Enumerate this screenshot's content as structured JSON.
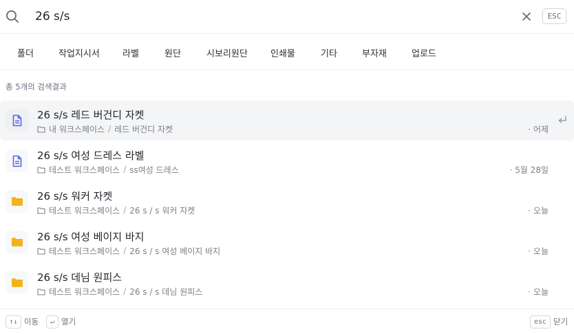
{
  "search": {
    "value": "26 s/s",
    "esc_label": "ESC"
  },
  "tabs": [
    {
      "label": "폴더"
    },
    {
      "label": "작업지시서"
    },
    {
      "label": "라벨"
    },
    {
      "label": "원단"
    },
    {
      "label": "시보리원단"
    },
    {
      "label": "인쇄물"
    },
    {
      "label": "기타"
    },
    {
      "label": "부자재"
    },
    {
      "label": "업로드"
    }
  ],
  "result_count": "총 5개의 검색결과",
  "results": [
    {
      "icon": "document-icon",
      "title": "26 s/s 레드 버건디 자켓",
      "workspace": "내 워크스페이스",
      "path": "레드 버건디 자켓",
      "date": "· 어제"
    },
    {
      "icon": "document-icon",
      "title": "26 s/s 여성 드레스 라벨",
      "workspace": "테스트 워크스페이스",
      "path": "ss여성 드레스",
      "date": "· 5월 28일"
    },
    {
      "icon": "folder-icon",
      "title": "26 s/s 워커 자켓",
      "workspace": "테스트 워크스페이스",
      "path": "26 s / s 워커 자켓",
      "date": "· 오늘"
    },
    {
      "icon": "folder-icon",
      "title": "26 s/s 여성 베이지 바지",
      "workspace": "테스트 워크스페이스",
      "path": "26 s / s 여성 베이지 바지",
      "date": "· 오늘"
    },
    {
      "icon": "folder-icon",
      "title": "26 s/s 데님 원피스",
      "workspace": "테스트 워크스페이스",
      "path": "26 s / s 데님 원피스",
      "date": "· 오늘"
    }
  ],
  "path_separator": "/",
  "footer": {
    "move_key": "↑↓",
    "move_label": "이동",
    "open_key": "↵",
    "open_label": "열기",
    "close_key": "esc",
    "close_label": "닫기"
  },
  "colors": {
    "document_icon": "#5b63e8",
    "folder_icon": "#f2b21b",
    "active_row_bg": "#f4f5f6"
  }
}
